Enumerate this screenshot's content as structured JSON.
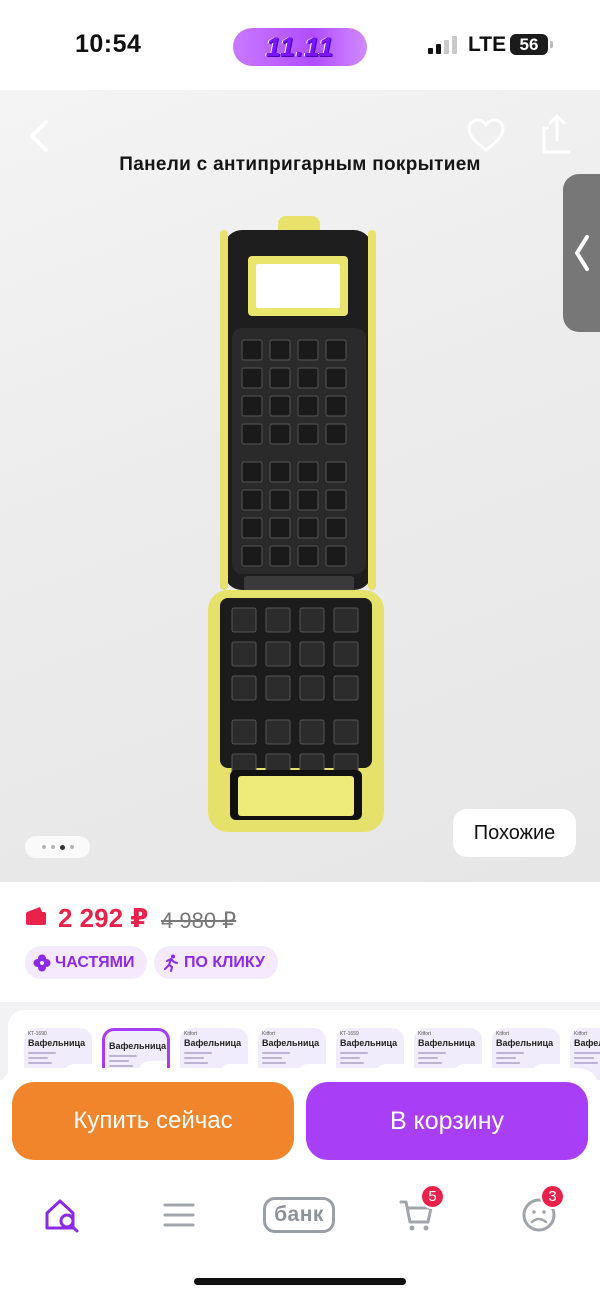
{
  "status_bar": {
    "time": "10:54",
    "promo_label": "11.11",
    "network": "LTE",
    "battery": "56"
  },
  "gallery": {
    "image_caption": "Панели с антипригарным покрытием",
    "similar_label": "Похожие",
    "dots_count": 4,
    "active_dot": 2
  },
  "price": {
    "current": "2 292 ₽",
    "old": "4 980 ₽",
    "current_color": "#e8224a"
  },
  "badges": {
    "installments": "ЧАСТЯМИ",
    "one_click": "ПО КЛИКУ"
  },
  "variants": [
    {
      "title": "Вафельница",
      "head": "КТ-1690"
    },
    {
      "title": "Вафельница",
      "head": "",
      "selected": true
    },
    {
      "title": "Вафельница",
      "head": "Kitfort"
    },
    {
      "title": "Вафельница",
      "head": "Kitfort"
    },
    {
      "title": "Вафельница",
      "head": "КТ-1659"
    },
    {
      "title": "Вафельница",
      "head": "Kitfort"
    },
    {
      "title": "Вафельница",
      "head": "Kitfort"
    },
    {
      "title": "Вафельница",
      "head": "Kitfort"
    }
  ],
  "actions": {
    "buy_now": "Купить сейчас",
    "add_to_cart": "В корзину",
    "buy_color": "#f0852b",
    "cart_color": "#a93ef7"
  },
  "bottom_nav": {
    "bank_label": "банк",
    "cart_badge": "5",
    "profile_badge": "3",
    "icons": [
      "home-search-icon",
      "catalog-icon",
      "bank-icon",
      "cart-icon",
      "profile-icon"
    ],
    "accent": "#8d2ae8"
  }
}
